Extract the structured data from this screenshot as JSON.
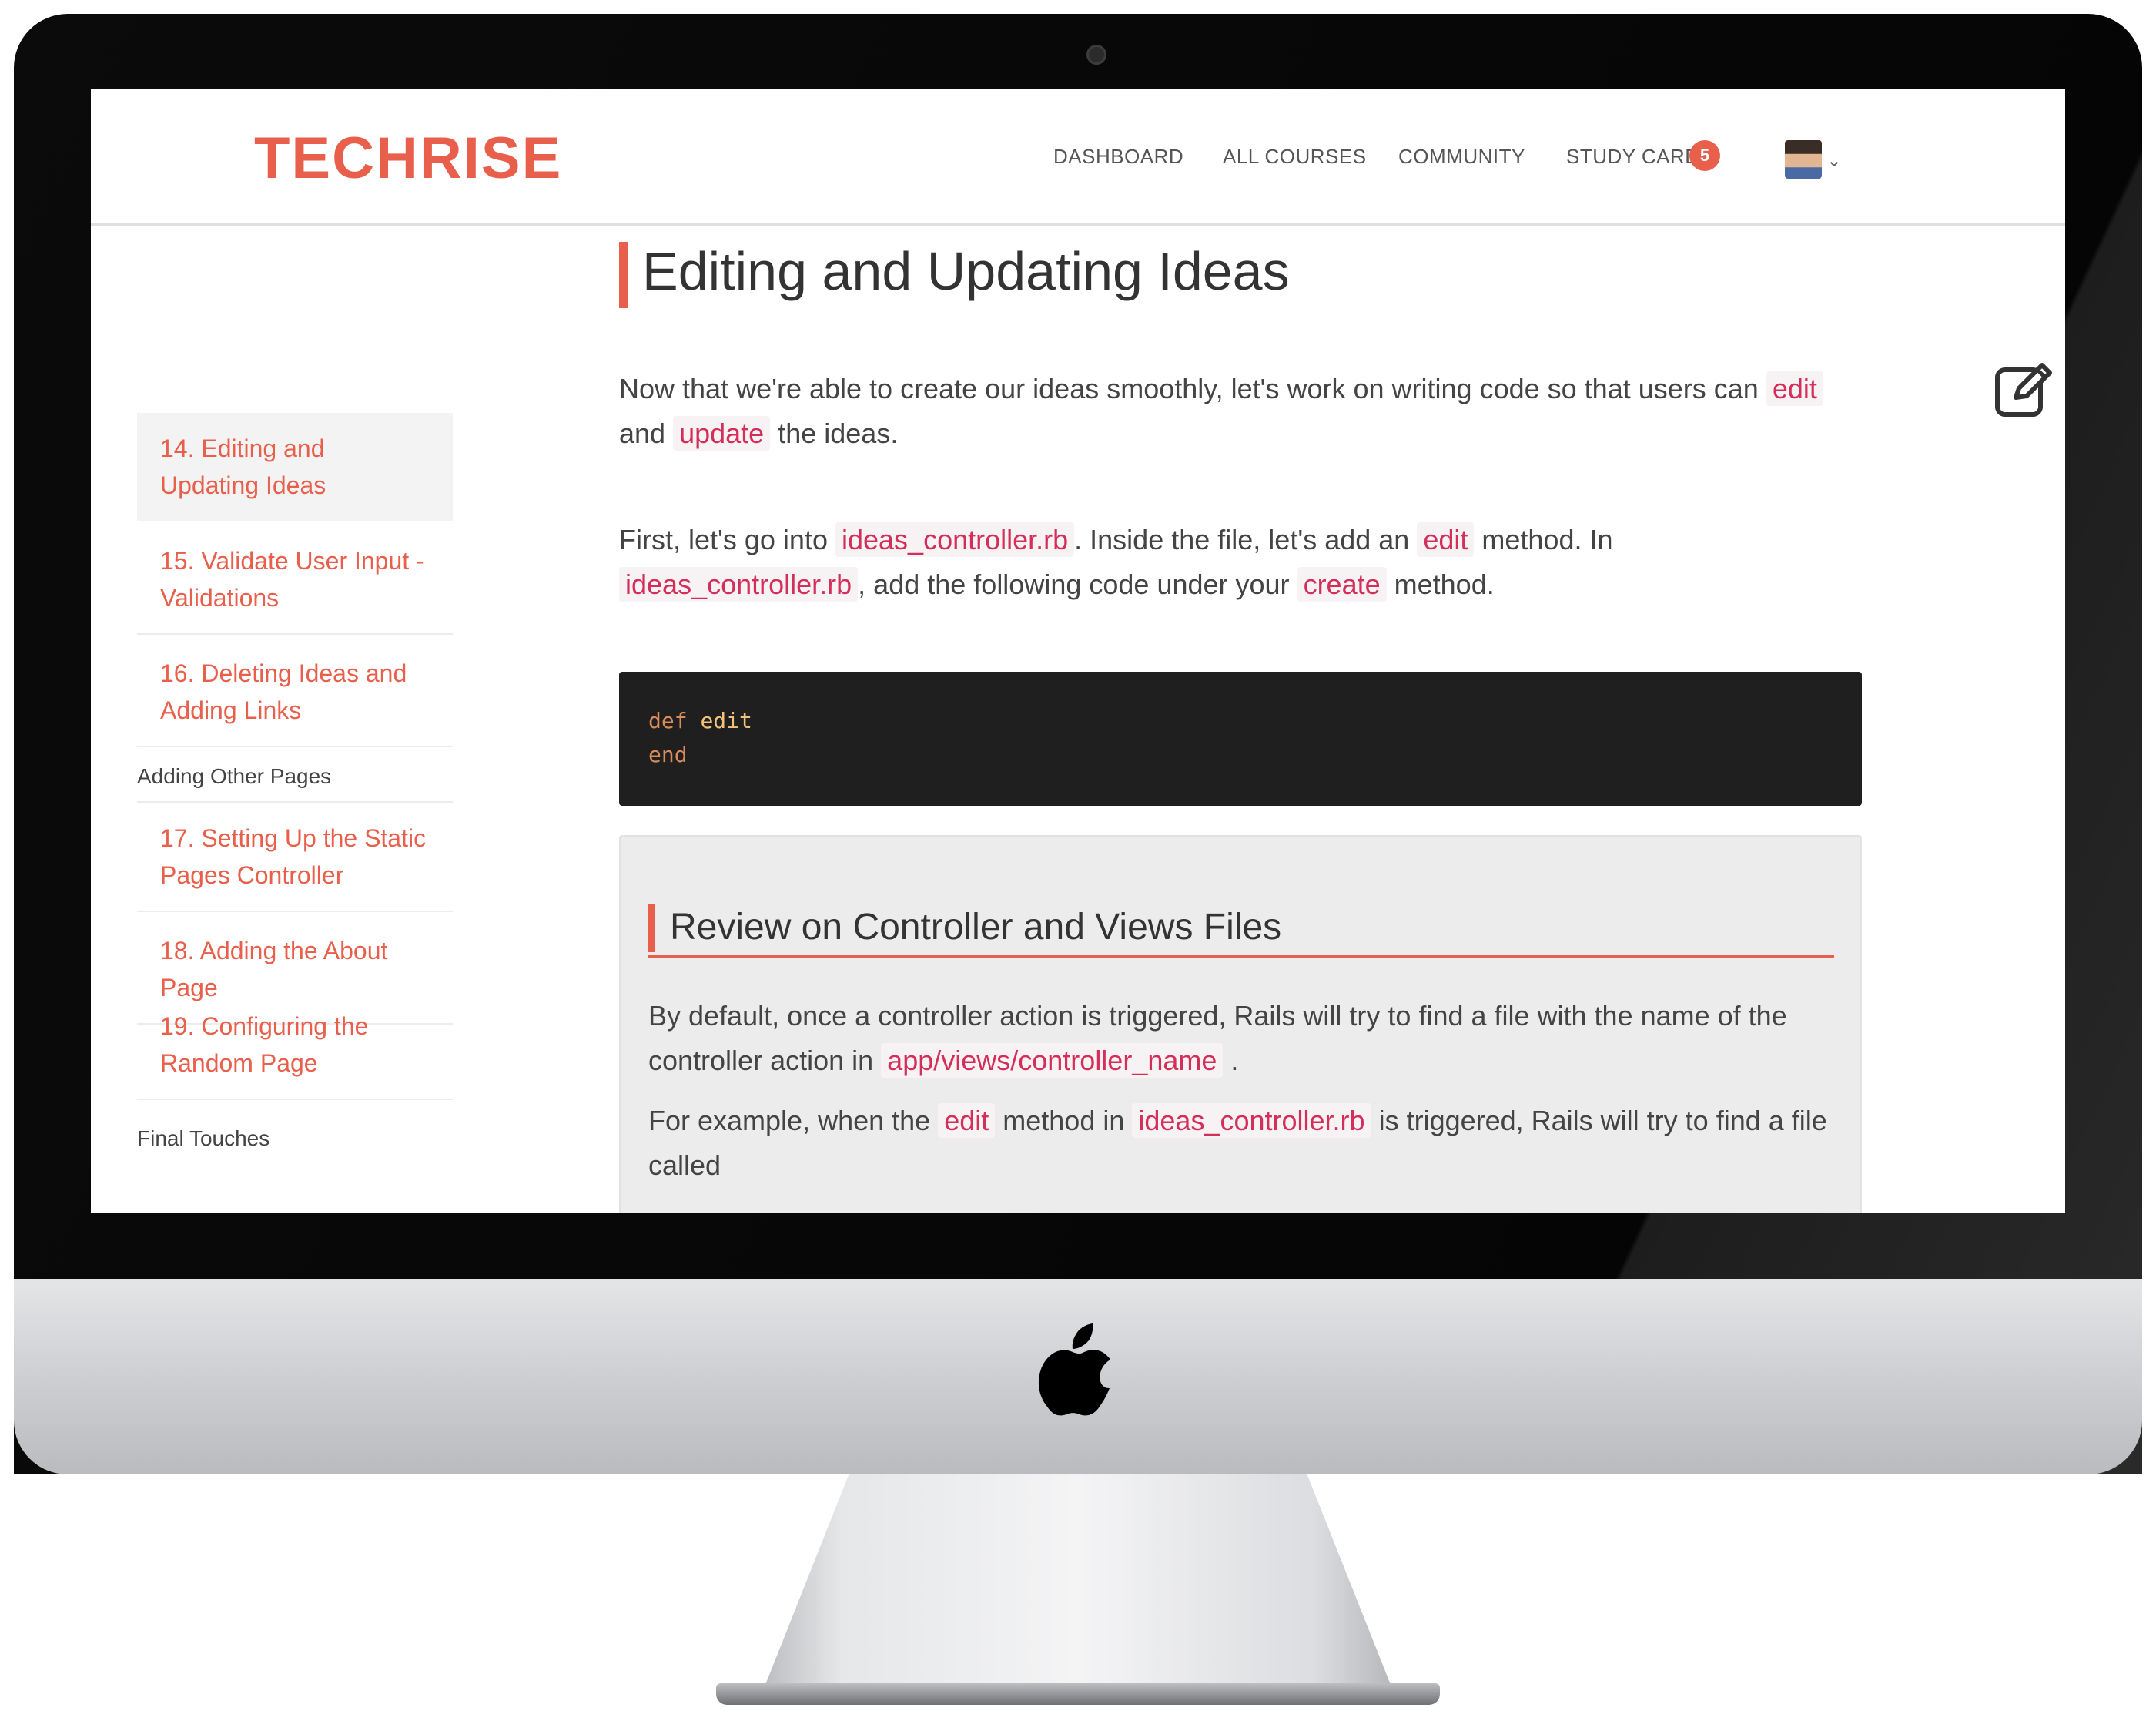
{
  "brand": "TECHRISE",
  "nav": {
    "dashboard": "DASHBOARD",
    "all_courses": "ALL COURSES",
    "community": "COMMUNITY",
    "study_cards": "STUDY CARDS",
    "study_cards_badge": "5"
  },
  "sidebar": {
    "items": [
      {
        "label": "14. Editing and Updating Ideas",
        "active": true
      },
      {
        "label": "15. Validate User Input - Validations"
      },
      {
        "label": "16. Deleting Ideas and Adding Links"
      }
    ],
    "section_2": "Adding Other Pages",
    "items_2": [
      {
        "label": "17. Setting Up the Static Pages Controller"
      },
      {
        "label": "18. Adding the About Page"
      },
      {
        "label": "19. Configuring the Random Page"
      }
    ],
    "section_3": "Final Touches"
  },
  "main": {
    "title": "Editing and Updating Ideas",
    "p1": {
      "t1": "Now that we're able to create our ideas smoothly, let's work on writing code so that users can",
      "c1": "edit",
      "t2": "and",
      "c2": "update",
      "t3": "the ideas."
    },
    "p2": {
      "t1": "First, let's go into",
      "c1": "ideas_controller.rb",
      "t2": ". Inside the file, let's add an",
      "c2": "edit",
      "t3": "method. In",
      "c3": "ideas_controller.rb",
      "t4": ", add the following code under your",
      "c4": "create",
      "t5": "method."
    },
    "code": {
      "kw_def": "def",
      "fn_name": "edit",
      "kw_end": "end"
    },
    "review": {
      "title": "Review on Controller and Views Files",
      "p1": {
        "t1": "By default, once a controller action is triggered, Rails will try to find a file with the name of the controller action in",
        "c1": "app/views/controller_name",
        "t2": "."
      },
      "p2": {
        "t1": "For example, when the",
        "c1": "edit",
        "t2": "method in",
        "c2": "ideas_controller.rb",
        "t3": "is triggered, Rails will try to find a file called"
      }
    }
  },
  "icons": {
    "edit": "edit-note-icon",
    "apple": "apple-logo-icon",
    "chevron": "chevron-down-icon"
  },
  "colors": {
    "accent": "#e8604c",
    "inline_code": "#d32f5a",
    "code_bg": "#1f1f1f"
  }
}
